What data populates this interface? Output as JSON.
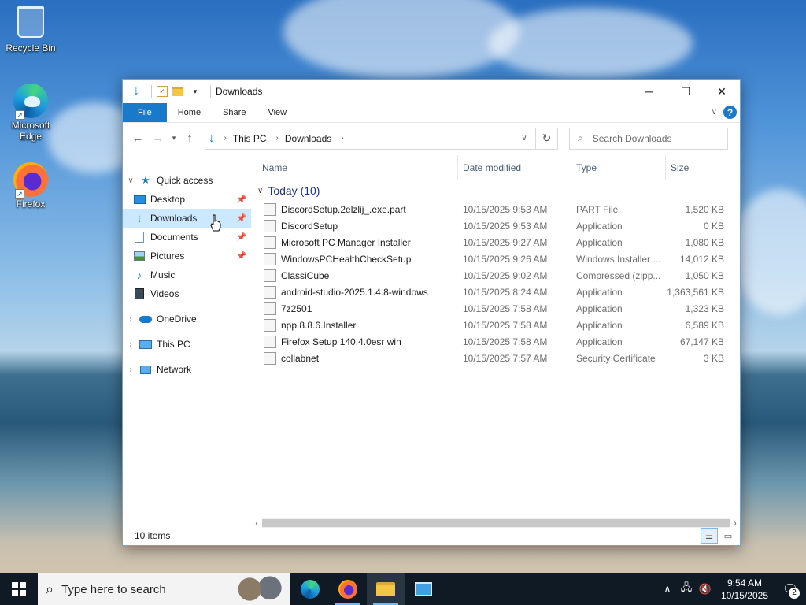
{
  "desktop": {
    "icons": [
      {
        "label": "Recycle Bin",
        "icon": "recycle-bin-icon"
      },
      {
        "label": "Microsoft Edge",
        "icon": "edge-icon"
      },
      {
        "label": "Firefox",
        "icon": "firefox-icon"
      }
    ]
  },
  "window": {
    "title": "Downloads",
    "ribbon_tabs": [
      "File",
      "Home",
      "Share",
      "View"
    ],
    "address": {
      "crumbs": [
        "This PC",
        "Downloads"
      ]
    },
    "search": {
      "placeholder": "Search Downloads"
    },
    "nav_pane": {
      "quick_access": "Quick access",
      "quick_items": [
        {
          "label": "Desktop",
          "icon": "desktop-folder-icon",
          "pinned": true
        },
        {
          "label": "Downloads",
          "icon": "downloads-folder-icon",
          "pinned": true,
          "selected": true
        },
        {
          "label": "Documents",
          "icon": "documents-folder-icon",
          "pinned": true
        },
        {
          "label": "Pictures",
          "icon": "pictures-folder-icon",
          "pinned": true
        },
        {
          "label": "Music",
          "icon": "music-folder-icon",
          "pinned": false
        },
        {
          "label": "Videos",
          "icon": "videos-folder-icon",
          "pinned": false
        }
      ],
      "onedrive": "OneDrive",
      "this_pc": "This PC",
      "network": "Network"
    },
    "columns": {
      "name": "Name",
      "date": "Date modified",
      "type": "Type",
      "size": "Size"
    },
    "group": "Today (10)",
    "files": [
      {
        "name": "DiscordSetup.2elzlij_.exe.part",
        "date": "10/15/2025 9:53 AM",
        "type": "PART File",
        "size": "1,520 KB"
      },
      {
        "name": "DiscordSetup",
        "date": "10/15/2025 9:53 AM",
        "type": "Application",
        "size": "0 KB"
      },
      {
        "name": "Microsoft PC Manager Installer",
        "date": "10/15/2025 9:27 AM",
        "type": "Application",
        "size": "1,080 KB"
      },
      {
        "name": "WindowsPCHealthCheckSetup",
        "date": "10/15/2025 9:26 AM",
        "type": "Windows Installer ...",
        "size": "14,012 KB"
      },
      {
        "name": "ClassiCube",
        "date": "10/15/2025 9:02 AM",
        "type": "Compressed (zipp...",
        "size": "1,050 KB"
      },
      {
        "name": "android-studio-2025.1.4.8-windows",
        "date": "10/15/2025 8:24 AM",
        "type": "Application",
        "size": "1,363,561 KB"
      },
      {
        "name": "7z2501",
        "date": "10/15/2025 7:58 AM",
        "type": "Application",
        "size": "1,323 KB"
      },
      {
        "name": "npp.8.8.6.Installer",
        "date": "10/15/2025 7:58 AM",
        "type": "Application",
        "size": "6,589 KB"
      },
      {
        "name": "Firefox Setup 140.4.0esr win",
        "date": "10/15/2025 7:58 AM",
        "type": "Application",
        "size": "67,147 KB"
      },
      {
        "name": "collabnet",
        "date": "10/15/2025 7:57 AM",
        "type": "Security Certificate",
        "size": "3 KB"
      }
    ],
    "status": "10 items"
  },
  "taskbar": {
    "search_placeholder": "Type here to search",
    "time": "9:54 AM",
    "date": "10/15/2025",
    "notification_count": "2"
  }
}
